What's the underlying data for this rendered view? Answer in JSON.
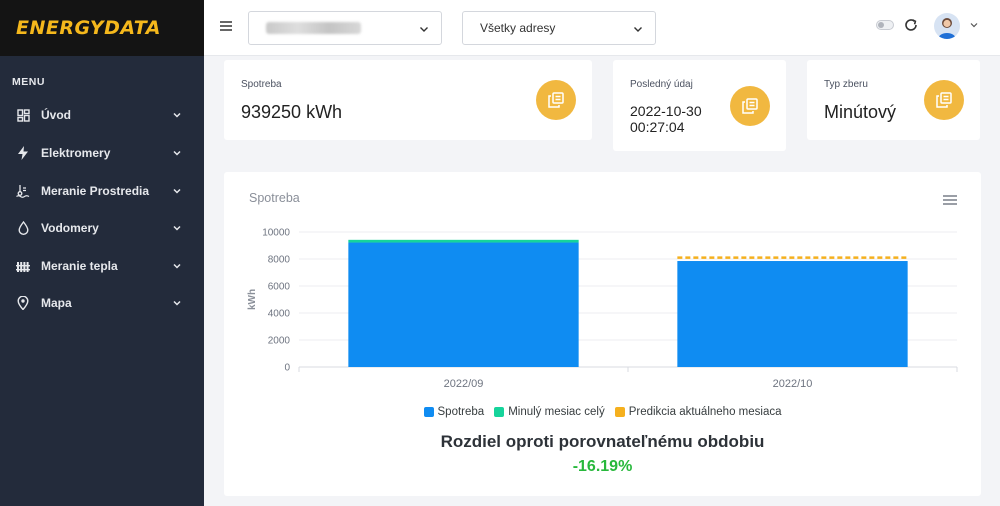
{
  "brand": {
    "name": "ENERGYDATA"
  },
  "sidebar": {
    "heading": "MENU",
    "items": [
      {
        "label": "Úvod",
        "icon": "dashboard-icon"
      },
      {
        "label": "Elektromery",
        "icon": "lightning-icon"
      },
      {
        "label": "Meranie Prostredia",
        "icon": "environment-icon"
      },
      {
        "label": "Vodomery",
        "icon": "water-drop-icon"
      },
      {
        "label": "Meranie tepla",
        "icon": "heating-icon"
      },
      {
        "label": "Mapa",
        "icon": "map-pin-icon"
      }
    ]
  },
  "topbar": {
    "address_select": {
      "value": "Všetky adresy"
    }
  },
  "cards": {
    "consumption": {
      "title": "Spotreba",
      "value": "939250 kWh"
    },
    "last_record": {
      "title": "Posledný údaj",
      "value_line1": "2022-10-30",
      "value_line2": "00:27:04"
    },
    "collection_type": {
      "title": "Typ zberu",
      "value": "Minútový"
    }
  },
  "chart_card": {
    "title": "Spotreba",
    "diff_title": "Rozdiel oproti porovnateľnému obdobiu",
    "diff_value": "-16.19%"
  },
  "colors": {
    "sidebar_bg": "#232b3b",
    "accent_gold": "#f1b840",
    "bar_blue": "#0f8cf2",
    "bar_green": "#16d49b",
    "prediction_orange": "#f5b01e",
    "positive_green": "#28b83c"
  },
  "chart_data": {
    "type": "bar",
    "stacked": true,
    "title": "",
    "xlabel": "",
    "ylabel": "kWh",
    "ylim": [
      0,
      10000
    ],
    "yticks": [
      0,
      2000,
      4000,
      6000,
      8000,
      10000
    ],
    "categories": [
      "2022/09",
      "2022/10"
    ],
    "series": [
      {
        "name": "Spotreba",
        "color": "#0f8cf2",
        "values": [
          9220,
          7850
        ]
      },
      {
        "name": "Minulý mesiac celý",
        "color": "#16d49b",
        "values": [
          200,
          0
        ]
      },
      {
        "name": "Predikcia aktuálneho mesiaca",
        "color": "#f5b01e",
        "values": [
          0,
          250
        ],
        "style": "dashed-line-top"
      }
    ],
    "grid": true,
    "legend": "bottom-center"
  }
}
